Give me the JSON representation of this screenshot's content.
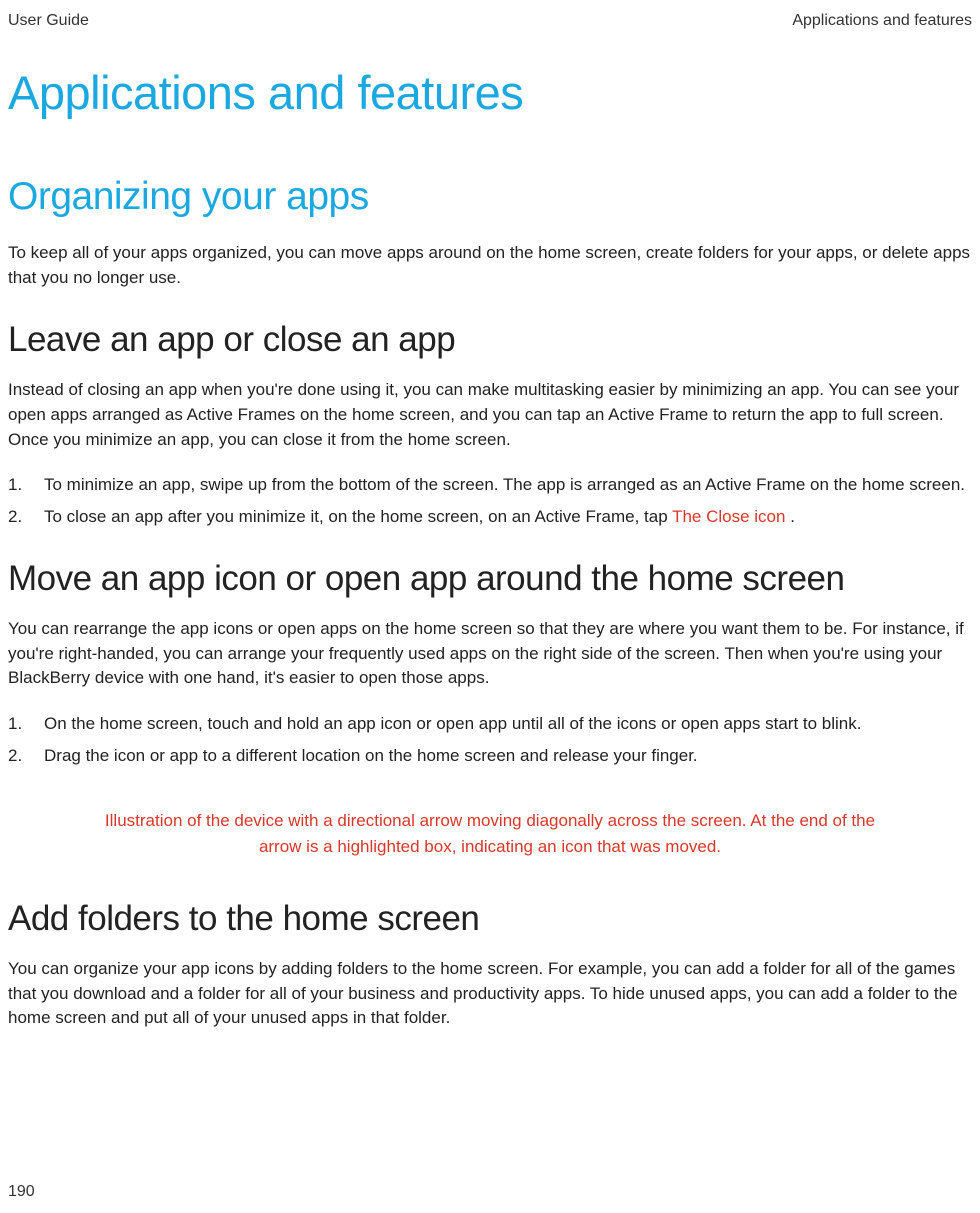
{
  "header": {
    "left": "User Guide",
    "right": "Applications and features"
  },
  "h1": "Applications and features",
  "h2": "Organizing your apps",
  "intro": "To keep all of your apps organized, you can move apps around on the home screen, create folders for your apps, or delete apps that you no longer use.",
  "section1": {
    "title": "Leave an app or close an app",
    "para": "Instead of closing an app when you're done using it, you can make multitasking easier by minimizing an app. You can see your open apps arranged as Active Frames on the home screen, and you can tap an Active Frame to return the app to full screen. Once you minimize an app, you can close it from the home screen.",
    "steps": [
      {
        "num": "1.",
        "text": "To minimize an app, swipe up from the bottom of the screen. The app is arranged as an Active Frame on the home screen."
      },
      {
        "num": "2.",
        "prefix": "To close an app after you minimize it, on the home screen, on an Active Frame, tap  ",
        "icon": "The Close icon",
        "suffix": "  ."
      }
    ]
  },
  "section2": {
    "title": "Move an app icon or open app around the home screen",
    "para": "You can rearrange the app icons or open apps on the home screen so that they are where you want them to be. For instance, if you're right-handed, you can arrange your frequently used apps on the right side of the screen. Then when you're using your BlackBerry device with one hand, it's easier to open those apps.",
    "steps": [
      {
        "num": "1.",
        "text": "On the home screen, touch and hold an app icon or open app until all of the icons or open apps start to blink."
      },
      {
        "num": "2.",
        "text": "Drag the icon or app to a different location on the home screen and release your finger."
      }
    ],
    "illustration": "Illustration of the device with a directional arrow moving diagonally across the screen. At the end of the arrow is a highlighted box, indicating an icon that was moved."
  },
  "section3": {
    "title": "Add folders to the home screen",
    "para": "You can organize your app icons by adding folders to the home screen. For example, you can add a folder for all of the games that you download and a folder for all of your business and productivity apps. To hide unused apps, you can add a folder to the home screen and put all of your unused apps in that folder."
  },
  "page_num": "190"
}
